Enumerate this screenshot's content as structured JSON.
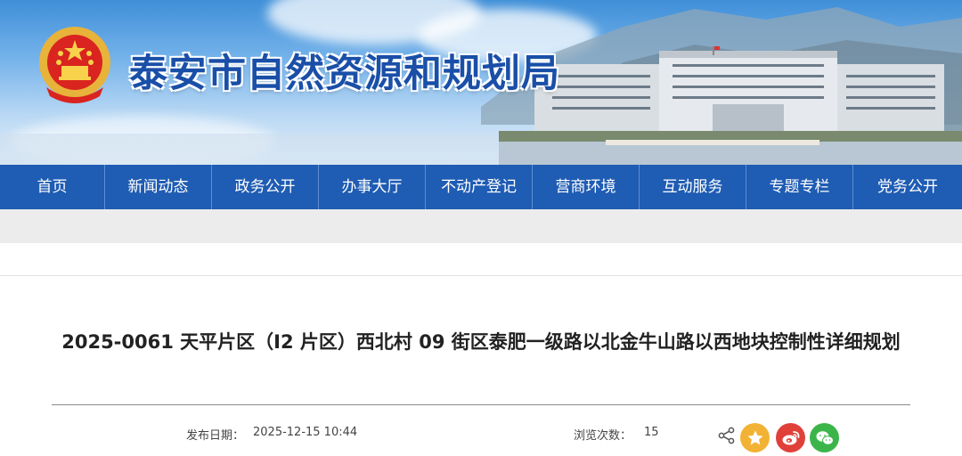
{
  "header": {
    "site_title": "泰安市自然资源和规划局"
  },
  "nav": {
    "items": [
      "首页",
      "新闻动态",
      "政务公开",
      "办事大厅",
      "不动产登记",
      "营商环境",
      "互动服务",
      "专题专栏",
      "党务公开"
    ]
  },
  "article": {
    "title": "2025-0061 天平片区（I2 片区）西北村 09 街区泰肥一级路以北金牛山路以西地块控制性详细规划",
    "publish_label": "发布日期：",
    "publish_date": "2025-12-15 10:44",
    "views_label": "浏览次数：",
    "views_count": "15"
  },
  "share": {
    "icons": [
      "share-icon",
      "qzone-icon",
      "weibo-icon",
      "wechat-icon"
    ]
  },
  "colors": {
    "nav_bg": "#1f5cb3",
    "title_text": "#1a4fa8",
    "qzone": "#f2b233",
    "weibo": "#e0403a",
    "wechat": "#3bb54a"
  }
}
